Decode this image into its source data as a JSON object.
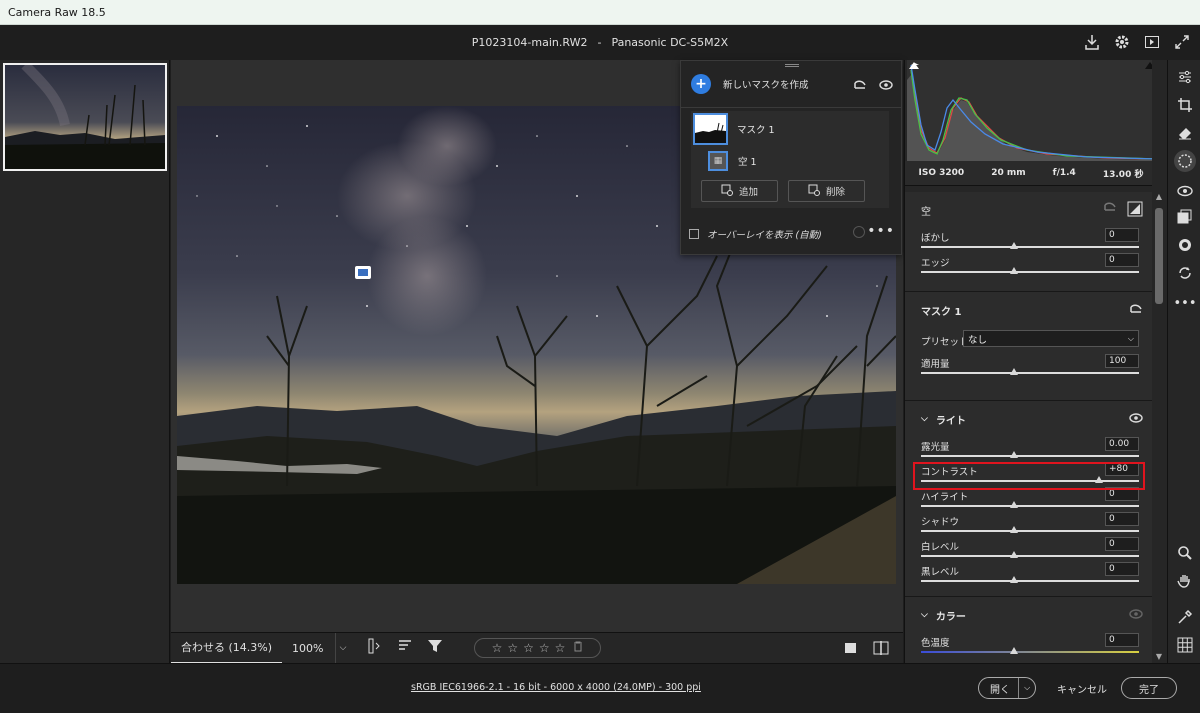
{
  "window": {
    "title": "Camera Raw 18.5"
  },
  "file": {
    "name": "P1023104-main.RW2",
    "separator": "-",
    "camera": "Panasonic DC-S5M2X"
  },
  "top_icons": [
    "save-icon",
    "gear-icon",
    "fullscreen-icon",
    "expand-icon"
  ],
  "mask_panel": {
    "create_label": "新しいマスクを作成",
    "mask_name": "マスク 1",
    "component_name": "空 1",
    "add_label": "追加",
    "delete_label": "削除",
    "overlay_label": "オーバーレイを表示 (自動)",
    "more": "•••"
  },
  "toolbar": {
    "fit_label": "合わせる (14.3%)",
    "zoom_label": "100%",
    "stars": [
      "☆",
      "☆",
      "☆",
      "☆",
      "☆"
    ]
  },
  "exif": {
    "iso": "ISO 3200",
    "focal": "20 mm",
    "aperture": "f/1.4",
    "shutter": "13.00 秒"
  },
  "sky_section": {
    "title": "空",
    "sliders": [
      {
        "label": "ぼかし",
        "value": "0",
        "position": 0.5
      },
      {
        "label": "エッジ",
        "value": "0",
        "position": 0.5
      }
    ]
  },
  "mask_section": {
    "title": "マスク 1",
    "preset_label": "プリセット",
    "preset_value": "なし",
    "amount": {
      "label": "適用量",
      "value": "100",
      "position": 0.5
    }
  },
  "light_section": {
    "title": "ライト",
    "sliders": [
      {
        "label": "露光量",
        "value": "0.00",
        "position": 0.5
      },
      {
        "label": "コントラスト",
        "value": "+80",
        "position": 0.9
      },
      {
        "label": "ハイライト",
        "value": "0",
        "position": 0.5
      },
      {
        "label": "シャドウ",
        "value": "0",
        "position": 0.5
      },
      {
        "label": "白レベル",
        "value": "0",
        "position": 0.5
      },
      {
        "label": "黒レベル",
        "value": "0",
        "position": 0.5
      }
    ]
  },
  "color_section": {
    "title": "カラー",
    "sliders": [
      {
        "label": "色温度",
        "value": "0",
        "position": 0.5
      }
    ]
  },
  "footer": {
    "info": "sRGB IEC61966-2.1 - 16 bit - 6000 x 4000 (24.0MP) - 300 ppi",
    "open_label": "開く",
    "cancel_label": "キャンセル",
    "done_label": "完了"
  },
  "colors": {
    "accent": "#2f7de1",
    "highlight": "#e0141e",
    "panel": "#2c2c2c"
  }
}
